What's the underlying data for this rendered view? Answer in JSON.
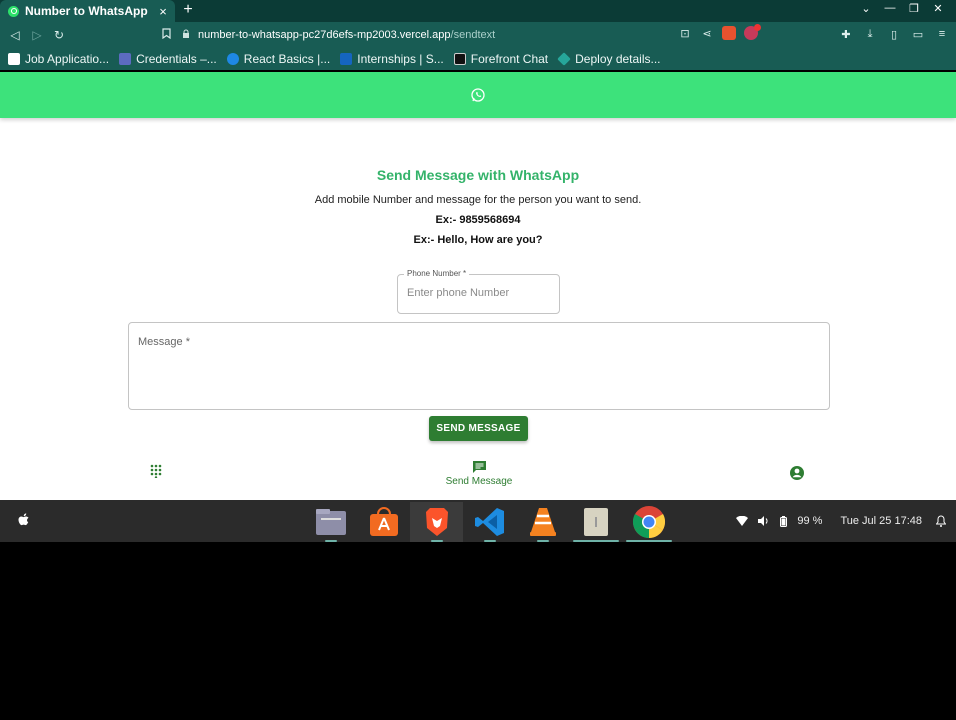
{
  "browser": {
    "tab_title": "Number to WhatsApp",
    "tab_close": "×",
    "new_tab": "+",
    "url_host": "number-to-whatsapp-pc27d6efs-mp2003.vercel.app",
    "url_path": "/sendtext",
    "bookmarks": [
      {
        "label": "Job Applicatio...",
        "icon_color": "#ffffff"
      },
      {
        "label": "Credentials –...",
        "icon_color": "#5c6bc0"
      },
      {
        "label": "React Basics |...",
        "icon_color": "#1e88e5"
      },
      {
        "label": "Internships | S...",
        "icon_color": "#1565c0"
      },
      {
        "label": "Forefront Chat",
        "icon_color": "#111111"
      },
      {
        "label": "Deploy details...",
        "icon_color": "#26a69a"
      }
    ]
  },
  "page": {
    "heading": "Send Message with WhatsApp",
    "description": "Add mobile Number and message for the person you want to send.",
    "example_number": "Ex:- 9859568694",
    "example_message": "Ex:- Hello, How are you?",
    "phone_label": "Phone Number *",
    "phone_placeholder": "Enter phone Number",
    "message_label": "Message *",
    "send_button": "SEND MESSAGE",
    "nav_send_label": "Send Message",
    "accent_color": "#3de27b",
    "button_color": "#2e7d32"
  },
  "taskbar": {
    "battery": "99 %",
    "datetime": "Tue Jul 25  17:48",
    "apps": [
      "files-icon",
      "app-store-icon",
      "brave-icon",
      "vscode-icon",
      "vlc-icon",
      "archive-icon",
      "chrome-icon"
    ]
  }
}
